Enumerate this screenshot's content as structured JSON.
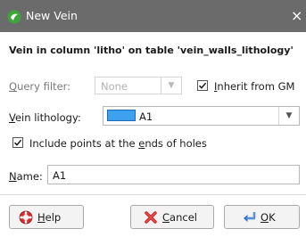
{
  "window": {
    "title": "New Vein",
    "close_glyph": "×",
    "app_icon": "leapfrog-app-icon",
    "titlebar_color": "#6b6b6b"
  },
  "heading": "Vein in column 'litho' on table 'vein_walls_lithology'",
  "query_filter": {
    "label_accel": "Q",
    "label_rest": "uery filter:",
    "value": "None",
    "disabled": true
  },
  "inherit_from_gm": {
    "checked": true,
    "label_accel": "I",
    "label_rest": "nherit from GM"
  },
  "vein_lithology": {
    "label_accel": "V",
    "label_rest": "ein lithology:",
    "value": "A1",
    "swatch_color": "#3ea1ef"
  },
  "include_points": {
    "checked": true,
    "label_before": "Include points at the ",
    "label_accel": "e",
    "label_after": "nds of holes"
  },
  "name": {
    "label_accel": "N",
    "label_rest": "ame:",
    "value": "A1"
  },
  "buttons": {
    "help": {
      "accel": "H",
      "rest": "elp",
      "icon": "lifebuoy-icon"
    },
    "cancel": {
      "accel": "C",
      "rest": "ancel",
      "icon": "red-x-icon"
    },
    "ok": {
      "accel": "O",
      "rest": "K",
      "icon": "return-arrow-icon"
    }
  }
}
